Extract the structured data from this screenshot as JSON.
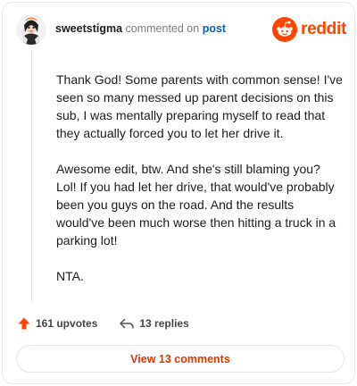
{
  "header": {
    "username": "sweetstigma",
    "verb": "commented on",
    "post_link": "post",
    "brand": "reddit"
  },
  "comment": {
    "paragraphs": [
      "Thank God! Some parents with common sense! I've seen so many messed up parent decisions on this sub, I was mentally preparing myself to read that they actually forced you to let her drive it.",
      "Awesome edit, btw. And she's still blaming you? Lol! If you had let her drive, that would've probably been you guys on the road. And the results would've been much worse then hitting a truck in a parking lot!",
      "NTA."
    ]
  },
  "actions": {
    "upvotes": "161 upvotes",
    "replies": "13 replies"
  },
  "footer": {
    "view_comments": "View 13 comments"
  },
  "colors": {
    "brand": "#ff4500",
    "link": "#0b5eb8",
    "button_text": "#d93a00"
  }
}
